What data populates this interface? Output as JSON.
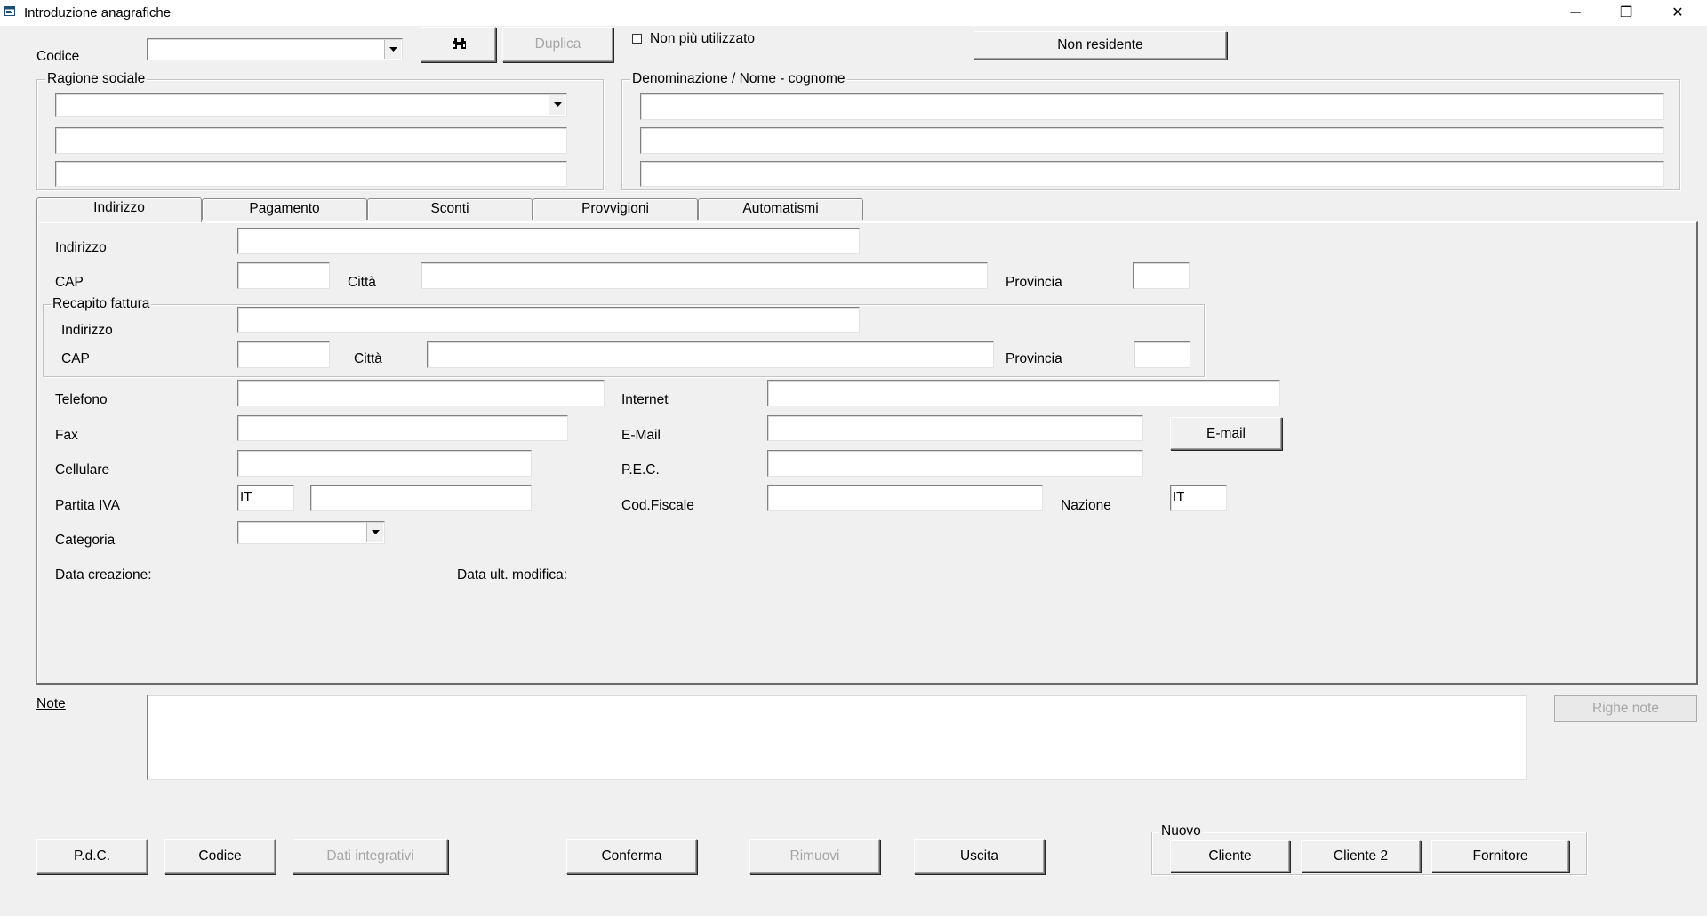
{
  "window": {
    "title": "Introduzione anagrafiche",
    "minimize_glyph": "─",
    "maximize_glyph": "❐",
    "close_glyph": "✕",
    "app_icon": "form-window-icon"
  },
  "header": {
    "codice_label": "Codice",
    "codice_value": "",
    "search_icon": "binoculars-icon",
    "duplica_label": "Duplica",
    "non_piu_utilizzato_label": "Non più utilizzato",
    "non_piu_utilizzato_checked": false,
    "non_residente_label": "Non residente"
  },
  "ragione_sociale": {
    "title": "Ragione sociale",
    "line1": "",
    "line2": "",
    "line3": ""
  },
  "denominazione": {
    "title": "Denominazione / Nome - cognome",
    "line1": "",
    "line2": "",
    "line3": ""
  },
  "tabs": {
    "indirizzo": "Indirizzo",
    "pagamento": "Pagamento",
    "sconti": "Sconti",
    "provvigioni": "Provvigioni",
    "automatismi": "Automatismi",
    "active": "Indirizzo"
  },
  "indirizzo_tab": {
    "indirizzo_label": "Indirizzo",
    "indirizzo_value": "",
    "cap_label": "CAP",
    "cap_value": "",
    "citta_label": "Città",
    "citta_value": "",
    "provincia_label": "Provincia",
    "provincia_value": "",
    "recapito": {
      "title": "Recapito fattura",
      "indirizzo_label": "Indirizzo",
      "indirizzo_value": "",
      "cap_label": "CAP",
      "cap_value": "",
      "citta_label": "Città",
      "citta_value": "",
      "provincia_label": "Provincia",
      "provincia_value": ""
    },
    "telefono_label": "Telefono",
    "telefono_value": "",
    "internet_label": "Internet",
    "internet_value": "",
    "fax_label": "Fax",
    "fax_value": "",
    "email_label": "E-Mail",
    "email_value": "",
    "email_button": "E-mail",
    "cellulare_label": "Cellulare",
    "cellulare_value": "",
    "pec_label": "P.E.C.",
    "pec_value": "",
    "partita_iva_label": "Partita IVA",
    "partita_iva_prefix": "IT",
    "partita_iva_value": "",
    "cod_fiscale_label": "Cod.Fiscale",
    "cod_fiscale_value": "",
    "nazione_label": "Nazione",
    "nazione_value": "IT",
    "categoria_label": "Categoria",
    "categoria_value": "",
    "data_creazione_label": "Data creazione:",
    "data_ult_modifica_label": "Data ult. modifica:"
  },
  "note": {
    "label": "Note",
    "value": "",
    "righe_note_label": "Righe note"
  },
  "footer": {
    "pdc_label": "P.d.C.",
    "codice_label": "Codice",
    "dati_integrativi_label": "Dati integrativi",
    "conferma_label": "Conferma",
    "rimuovi_label": "Rimuovi",
    "uscita_label": "Uscita",
    "nuovo_title": "Nuovo",
    "cliente_label": "Cliente",
    "cliente2_label": "Cliente 2",
    "fornitore_label": "Fornitore"
  }
}
